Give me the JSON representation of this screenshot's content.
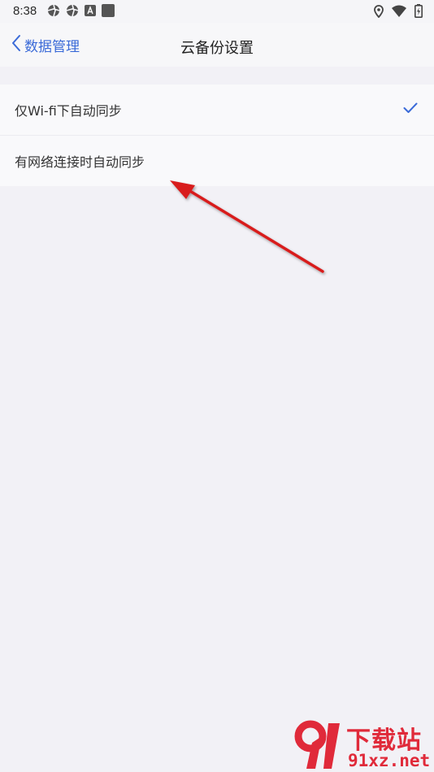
{
  "status_bar": {
    "time": "8:38",
    "left_icons": [
      "app-shutter-icon",
      "app-shutter-icon",
      "font-a-icon",
      "square-icon"
    ],
    "right_icons": [
      "location-icon",
      "wifi-icon",
      "battery-charging-icon"
    ]
  },
  "nav": {
    "back_label": "数据管理",
    "title": "云备份设置"
  },
  "options": [
    {
      "label": "仅Wi-fi下自动同步",
      "selected": true
    },
    {
      "label": "有网络连接时自动同步",
      "selected": false
    }
  ],
  "colors": {
    "accent": "#3a6ad8",
    "arrow": "#d81e1e",
    "background": "#f2f1f6",
    "watermark": "#e02a3a"
  },
  "watermark": {
    "logo_text": "91",
    "title": "下载站",
    "domain": "91xz.net"
  }
}
